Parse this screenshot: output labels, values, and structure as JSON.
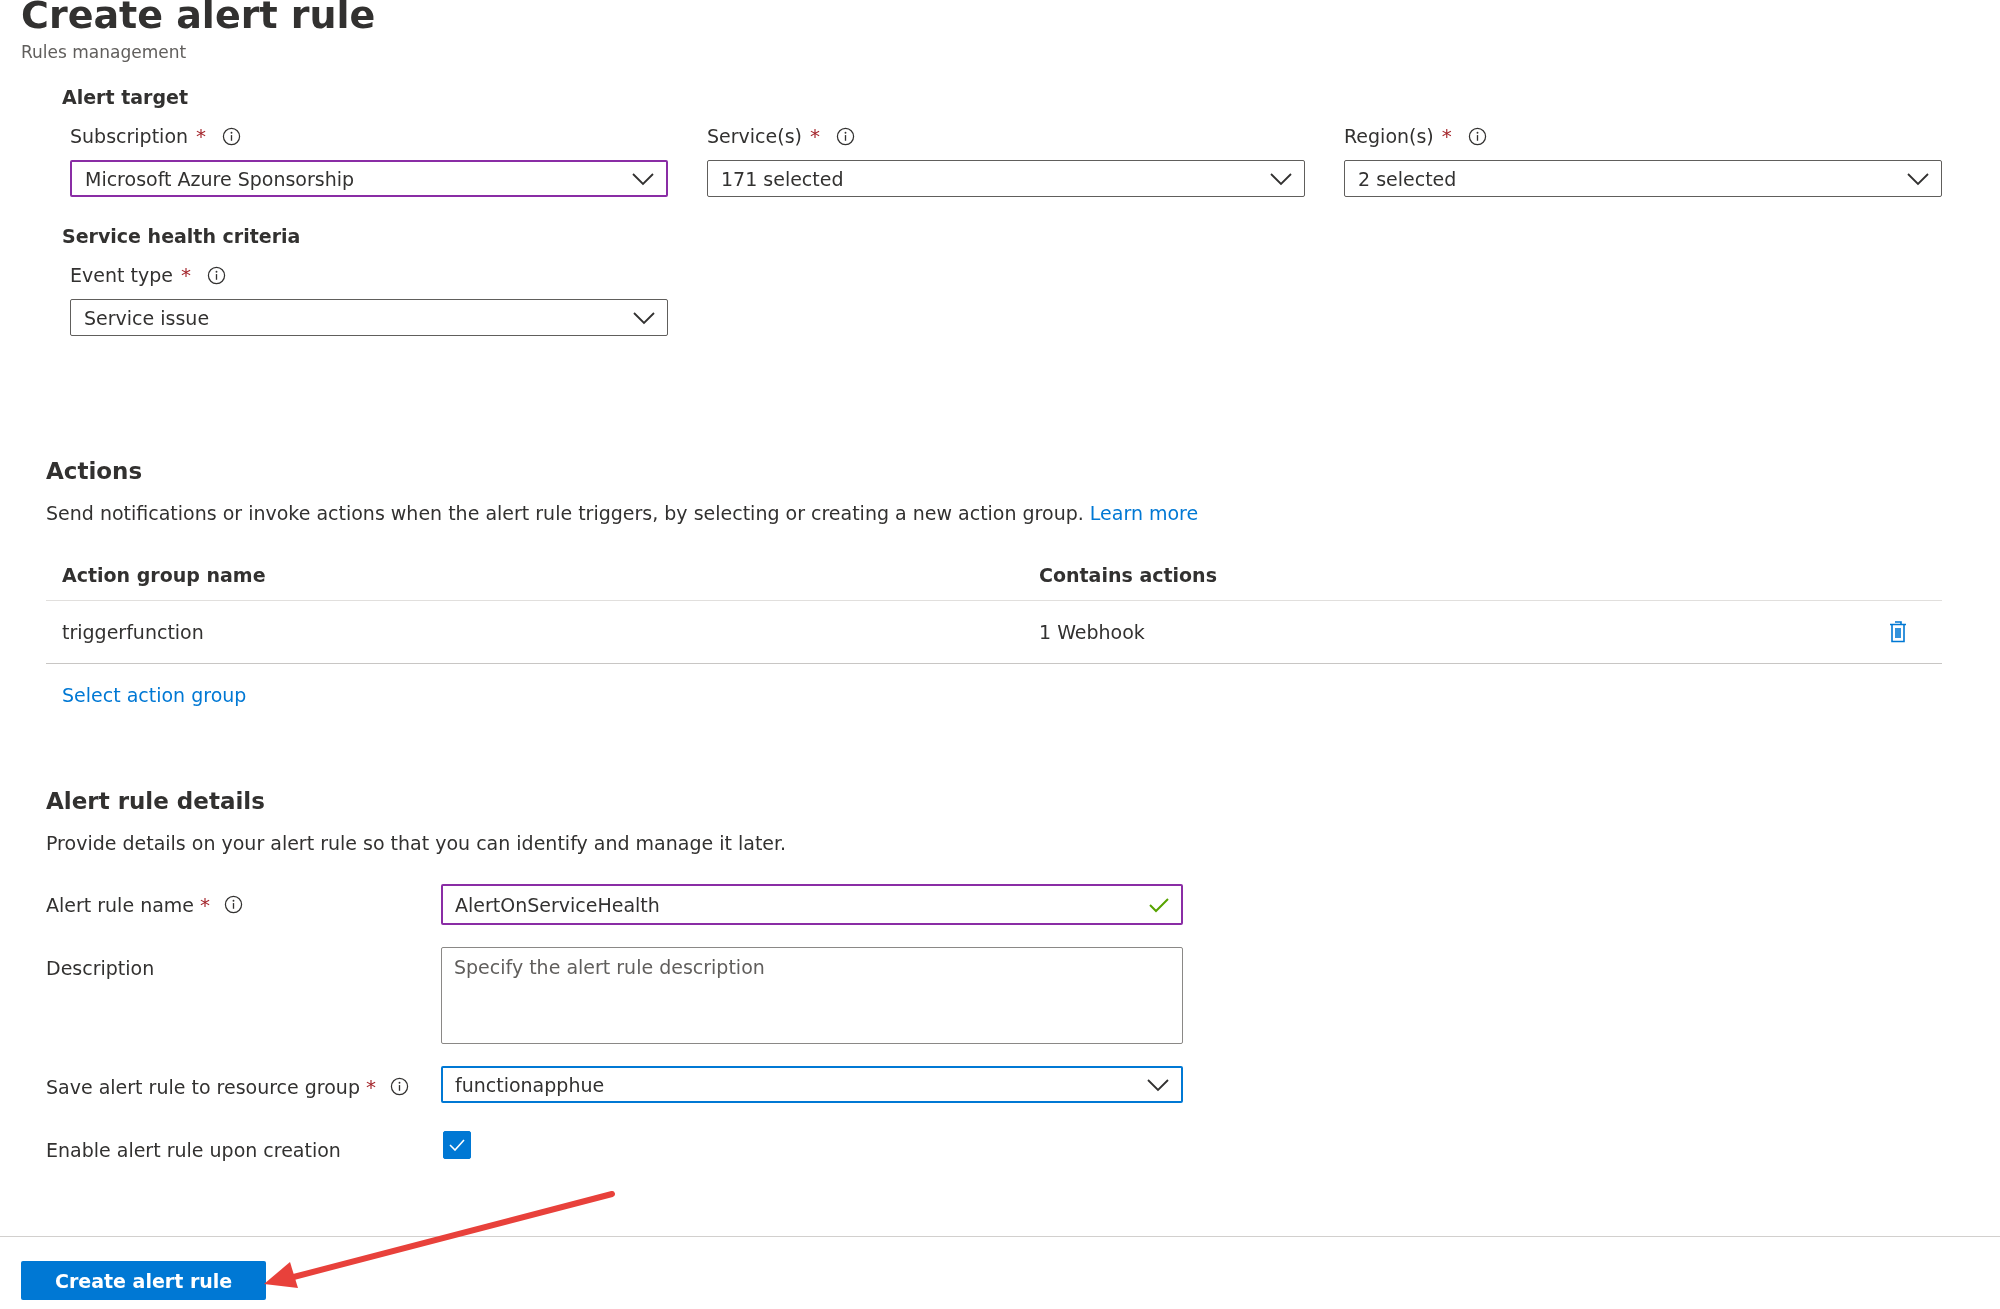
{
  "header": {
    "title": "Create alert rule",
    "subtitle": "Rules management"
  },
  "alert_target": {
    "heading": "Alert target",
    "fields": [
      {
        "label": "Subscription",
        "required": "*",
        "info": true,
        "value": "Microsoft Azure Sponsorship",
        "active": true,
        "focused": false
      },
      {
        "label": "Service(s)",
        "required": "*",
        "info": true,
        "value": "171 selected",
        "active": false,
        "focused": false
      },
      {
        "label": "Region(s)",
        "required": "*",
        "info": true,
        "value": "2 selected",
        "active": false,
        "focused": false
      }
    ]
  },
  "criteria": {
    "heading": "Service health criteria",
    "fields": [
      {
        "label": "Event type",
        "required": "*",
        "info": true,
        "value": "Service issue",
        "active": false,
        "focused": false
      }
    ]
  },
  "actions": {
    "heading": "Actions",
    "description": "Send notifications or invoke actions when the alert rule triggers, by selecting or creating a new action group.",
    "link": "Learn more",
    "columns": [
      "Action group name",
      "Contains actions"
    ],
    "rows": [
      {
        "name": "triggerfunction",
        "actions": "1 Webhook"
      }
    ],
    "select_link": "Select action group"
  },
  "details": {
    "heading": "Alert rule details",
    "description": "Provide details on your alert rule so that you can identify and manage it later.",
    "rows": [
      {
        "kind": "text",
        "label": "Alert rule name",
        "required": "*",
        "info": true,
        "value": "AlertOnServiceHealth",
        "active": true,
        "focused": false,
        "valid": true
      },
      {
        "kind": "textarea",
        "label": "Description",
        "info": false,
        "placeholder": "Specify the alert rule description",
        "active": false,
        "focused": false
      },
      {
        "kind": "dropdown",
        "label": "Save alert rule to resource group",
        "required": "*",
        "info": true,
        "value": "functionapphue",
        "active": false,
        "focused": true
      },
      {
        "kind": "checkbox",
        "label": "Enable alert rule upon creation",
        "info": false,
        "checked": true
      }
    ]
  },
  "footer": {
    "button": "Create alert rule"
  }
}
